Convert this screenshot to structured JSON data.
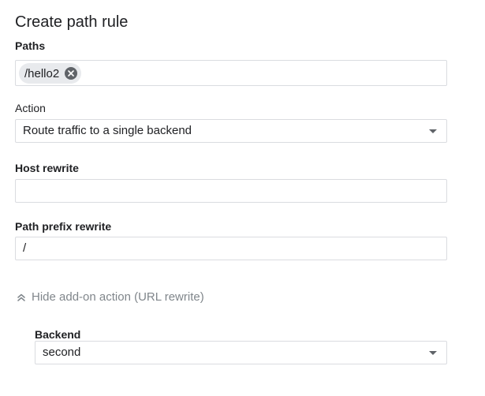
{
  "page": {
    "title": "Create path rule"
  },
  "paths": {
    "label": "Paths",
    "chips": [
      {
        "text": "/hello2"
      }
    ]
  },
  "action": {
    "label": "Action",
    "selected": "Route traffic to a single backend"
  },
  "host_rewrite": {
    "label": "Host rewrite",
    "value": ""
  },
  "path_prefix_rewrite": {
    "label": "Path prefix rewrite",
    "value": "/"
  },
  "addon_toggle": {
    "label": "Hide add-on action (URL rewrite)",
    "icon": "chevron-up-double-icon"
  },
  "backend": {
    "label": "Backend",
    "selected": "second"
  },
  "colors": {
    "border": "#dadce0",
    "chip_bg": "#e8eaed",
    "muted_text": "#80868b"
  }
}
